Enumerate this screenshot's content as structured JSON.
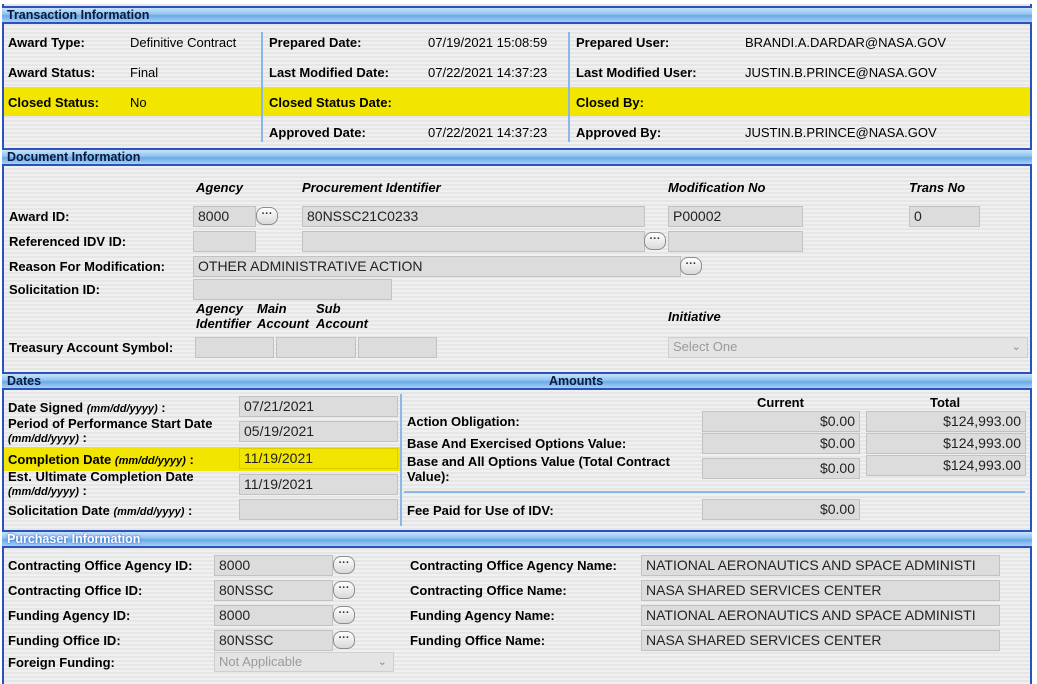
{
  "transaction": {
    "header": "Transaction Information",
    "award_type_label": "Award Type:",
    "award_type": "Definitive Contract",
    "award_status_label": "Award Status:",
    "award_status": "Final",
    "closed_status_label": "Closed Status:",
    "closed_status": "No",
    "prepared_date_label": "Prepared Date:",
    "prepared_date": "07/19/2021 15:08:59",
    "last_modified_date_label": "Last Modified Date:",
    "last_modified_date": "07/22/2021 14:37:23",
    "closed_status_date_label": "Closed Status Date:",
    "approved_date_label": "Approved Date:",
    "approved_date": "07/22/2021 14:37:23",
    "prepared_user_label": "Prepared User:",
    "prepared_user": "BRANDI.A.DARDAR@NASA.GOV",
    "last_modified_user_label": "Last Modified User:",
    "last_modified_user": "JUSTIN.B.PRINCE@NASA.GOV",
    "closed_by_label": "Closed By:",
    "approved_by_label": "Approved By:",
    "approved_by": "JUSTIN.B.PRINCE@NASA.GOV",
    "highlight_color": "#f2e600"
  },
  "document": {
    "header": "Document Information",
    "col_agency": "Agency",
    "col_procurement": "Procurement Identifier",
    "col_modification": "Modification No",
    "col_trans": "Trans No",
    "award_id_label": "Award ID:",
    "agency": "8000",
    "procurement_id": "80NSSC21C0233",
    "modification_no": "P00002",
    "trans_no": "0",
    "ref_idv_label": "Referenced IDV ID:",
    "reason_label": "Reason For Modification:",
    "reason": "OTHER ADMINISTRATIVE ACTION",
    "solicitation_label": "Solicitation ID:",
    "tas_agency_identifier": "Agency Identifier",
    "tas_main_account": "Main Account",
    "tas_sub_account": "Sub Account",
    "treasury_label": "Treasury Account Symbol:",
    "initiative_label": "Initiative",
    "initiative_value": "Select One",
    "ellipsis": "···"
  },
  "dates": {
    "header": "Dates",
    "date_signed_label": "Date Signed",
    "date_signed": "07/21/2021",
    "pop_start_label": "Period of Performance Start Date",
    "pop_start": "05/19/2021",
    "completion_label": "Completion Date",
    "completion": "11/19/2021",
    "est_completion_label": "Est. Ultimate Completion Date",
    "est_completion": "11/19/2021",
    "solicitation_date_label": "Solicitation Date",
    "format": "(mm/dd/yyyy)",
    "colon": ":"
  },
  "amounts": {
    "header": "Amounts",
    "col_current": "Current",
    "col_total": "Total",
    "action_obligation_label": "Action Obligation:",
    "action_obligation_current": "$0.00",
    "action_obligation_total": "$124,993.00",
    "base_exercised_label": "Base And Exercised Options Value:",
    "base_exercised_current": "$0.00",
    "base_exercised_total": "$124,993.00",
    "base_all_label_1": "Base and All Options Value (Total Contract",
    "base_all_label_2": "Value):",
    "base_all_current": "$0.00",
    "base_all_total": "$124,993.00",
    "fee_label": "Fee Paid for Use of IDV:",
    "fee_value": "$0.00"
  },
  "purchaser": {
    "header": "Purchaser Information",
    "co_agency_id_label": "Contracting Office Agency ID:",
    "co_agency_id": "8000",
    "co_id_label": "Contracting Office ID:",
    "co_id": "80NSSC",
    "funding_agency_id_label": "Funding Agency ID:",
    "funding_agency_id": "8000",
    "funding_office_id_label": "Funding Office ID:",
    "funding_office_id": "80NSSC",
    "foreign_funding_label": "Foreign Funding:",
    "foreign_funding": "Not Applicable",
    "co_agency_name_label": "Contracting Office Agency Name:",
    "co_agency_name": "NATIONAL AERONAUTICS AND SPACE ADMINISTI",
    "co_name_label": "Contracting Office Name:",
    "co_name": "NASA SHARED SERVICES CENTER",
    "funding_agency_name_label": "Funding Agency Name:",
    "funding_agency_name": "NATIONAL AERONAUTICS AND SPACE ADMINISTI",
    "funding_office_name_label": "Funding Office Name:",
    "funding_office_name": "NASA SHARED SERVICES CENTER"
  }
}
